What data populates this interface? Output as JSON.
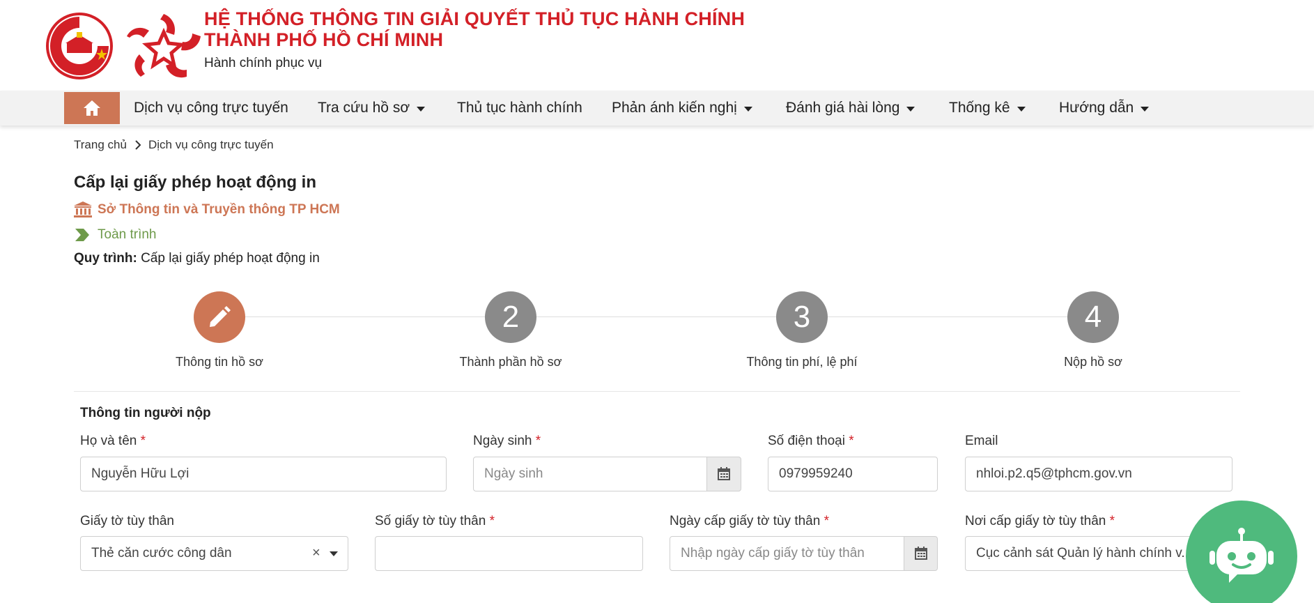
{
  "header": {
    "title_line1": "HỆ THỐNG THÔNG TIN GIẢI QUYẾT THỦ TỤC HÀNH CHÍNH",
    "title_line2": "THÀNH PHỐ HỒ CHÍ MINH",
    "subtitle": "Hành chính phục vụ"
  },
  "nav": {
    "items": [
      {
        "label": "Dịch vụ công trực tuyến"
      },
      {
        "label": "Tra cứu hồ sơ"
      },
      {
        "label": "Thủ tục hành chính"
      },
      {
        "label": "Phản ánh kiến nghị"
      },
      {
        "label": "Đánh giá hài lòng"
      },
      {
        "label": "Thống kê"
      },
      {
        "label": "Hướng dẫn"
      }
    ]
  },
  "breadcrumb": {
    "home": "Trang chủ",
    "current": "Dịch vụ công trực tuyến"
  },
  "procedure": {
    "title": "Cấp lại giấy phép hoạt động in",
    "agency": "Sở Thông tin và Truyền thông TP HCM",
    "scope": "Toàn trình",
    "process_label": "Quy trình:",
    "process_value": "Cấp lại giấy phép hoạt động in"
  },
  "steps": [
    {
      "number": "1",
      "label": "Thông tin hồ sơ"
    },
    {
      "number": "2",
      "label": "Thành phần hồ sơ"
    },
    {
      "number": "3",
      "label": "Thông tin phí, lệ phí"
    },
    {
      "number": "4",
      "label": "Nộp hồ sơ"
    }
  ],
  "form": {
    "section_title": "Thông tin người nộp",
    "full_name": {
      "label": "Họ và tên",
      "value": "Nguyễn Hữu Lợi"
    },
    "birth_date": {
      "label": "Ngày sinh",
      "placeholder": "Ngày sinh"
    },
    "phone": {
      "label": "Số điện thoại",
      "value": "0979959240"
    },
    "email": {
      "label": "Email",
      "value": "nhloi.p2.q5@tphcm.gov.vn"
    },
    "id_type": {
      "label": "Giấy tờ tùy thân",
      "value": "Thẻ căn cước công dân"
    },
    "id_number": {
      "label": "Số giấy tờ tùy thân",
      "value": ""
    },
    "id_issue_date": {
      "label": "Ngày cấp giấy tờ tùy thân",
      "placeholder": "Nhập ngày cấp giấy tờ tùy thân"
    },
    "id_issue_place": {
      "label": "Nơi cấp giấy tờ tùy thân",
      "value": "Cục cảnh sát Quản lý hành chính v..."
    }
  },
  "required_mark": "*",
  "clear_mark": "×",
  "colors": {
    "brand_red": "#d32027",
    "accent": "#cd7655",
    "scope_green": "#6e9a4a",
    "chatbot_green": "#4fba7d"
  }
}
